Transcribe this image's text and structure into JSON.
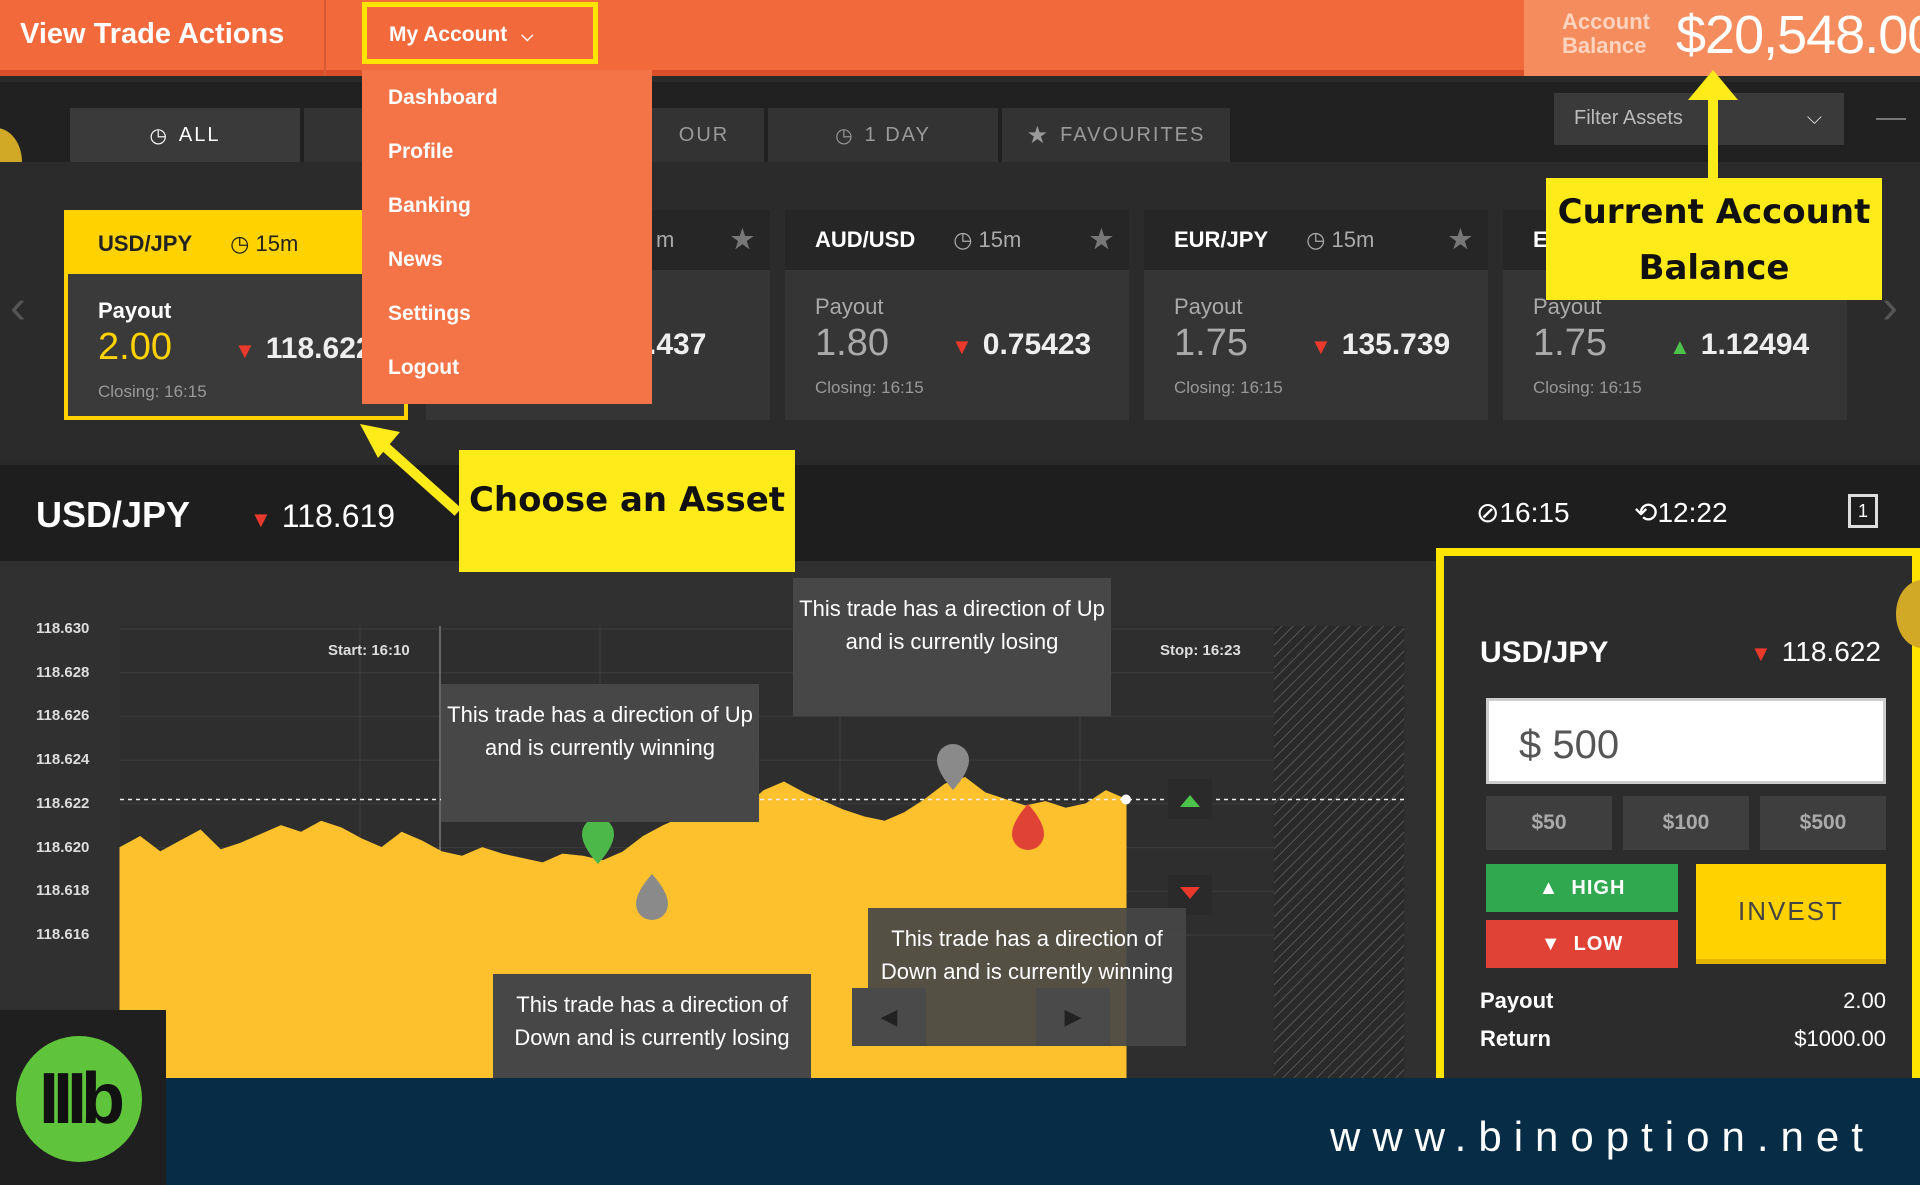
{
  "header": {
    "title": "View Trade Actions",
    "account_menu_label": "My Account",
    "balance_label": "Account Balance",
    "balance_value": "$20,548.00"
  },
  "account_menu": {
    "items": [
      "Dashboard",
      "Profile",
      "Banking",
      "News",
      "Settings",
      "Logout"
    ]
  },
  "tabs": [
    {
      "label": "ALL",
      "icon": "clock-icon",
      "active": true
    },
    {
      "label": "",
      "icon": "",
      "active": false
    },
    {
      "label": "OUR",
      "icon": "",
      "active": false
    },
    {
      "label": "1 DAY",
      "icon": "clock-icon",
      "active": false
    },
    {
      "label": "FAVOURITES",
      "icon": "star-icon",
      "active": false
    }
  ],
  "filter": {
    "placeholder": "Filter Assets"
  },
  "asset_cards": [
    {
      "pair": "USD/JPY",
      "expiry": "15m",
      "payout_label": "Payout",
      "payout": "2.00",
      "rate": "118.622",
      "direction": "down",
      "closing": "Closing: 16:15",
      "selected": true
    },
    {
      "pair": "",
      "expiry": "m",
      "payout_label": "",
      "payout": "",
      "rate": ".437",
      "direction": "",
      "closing": "",
      "selected": false
    },
    {
      "pair": "AUD/USD",
      "expiry": "15m",
      "payout_label": "Payout",
      "payout": "1.80",
      "rate": "0.75423",
      "direction": "down",
      "closing": "Closing: 16:15",
      "selected": false
    },
    {
      "pair": "EUR/JPY",
      "expiry": "15m",
      "payout_label": "Payout",
      "payout": "1.75",
      "rate": "135.739",
      "direction": "down",
      "closing": "Closing: 16:15",
      "selected": false
    },
    {
      "pair": "E",
      "expiry": "",
      "payout_label": "Payout",
      "payout": "1.75",
      "rate": "1.12494",
      "direction": "up",
      "closing": "Closing: 16:15",
      "selected": false
    }
  ],
  "callouts": {
    "balance": "Current Account Balance",
    "asset": "Choose an Asset"
  },
  "info_bar": {
    "pair": "USD/JPY",
    "rate": "118.619",
    "expiry_time": "16:15",
    "current_time": "12:22",
    "view_icon_label": "1"
  },
  "chart": {
    "y_ticks": [
      "118.630",
      "118.628",
      "118.626",
      "118.624",
      "118.622",
      "118.620",
      "118.618",
      "118.616"
    ],
    "start_label": "Start: 16:10",
    "stop_label": "Stop: 16:23",
    "bubbles": [
      "This trade has a direction of Up and is currently losing",
      "This trade has a direction of Up and is currently winning",
      "This trade has a direction of Down and is currently winning",
      "This trade has a direction of Down and is currently losing"
    ]
  },
  "chart_data": {
    "type": "area",
    "title": "",
    "xlabel": "",
    "ylabel": "",
    "ylim": [
      118.615,
      118.631
    ],
    "y": [
      118.62,
      118.6205,
      118.6198,
      118.6203,
      118.6208,
      118.6199,
      118.6202,
      118.6206,
      118.621,
      118.6207,
      118.6212,
      118.6209,
      118.6204,
      118.62,
      118.6207,
      118.6203,
      118.6198,
      118.6196,
      118.62,
      118.6197,
      118.6195,
      118.6193,
      118.6197,
      118.6196,
      118.6194,
      118.6198,
      118.6205,
      118.621,
      118.6214,
      118.622,
      118.6221,
      118.6218,
      118.6226,
      118.623,
      118.6225,
      118.6221,
      118.6217,
      118.6214,
      118.6212,
      118.6216,
      118.6222,
      118.6229,
      118.6232,
      118.6225,
      118.6222,
      118.6219,
      118.6221,
      118.6218,
      118.622,
      118.6226,
      118.6222
    ]
  },
  "panel": {
    "pair": "USD/JPY",
    "rate": "118.622",
    "amount": "$ 500",
    "quick_amounts": [
      "$50",
      "$100",
      "$500"
    ],
    "high_label": "HIGH",
    "low_label": "LOW",
    "invest_label": "INVEST",
    "payout_label": "Payout",
    "payout_value": "2.00",
    "return_label": "Return",
    "return_value": "$1000.00"
  },
  "footer": {
    "url": "www.binoption.net",
    "logo_text": "IIIb"
  }
}
